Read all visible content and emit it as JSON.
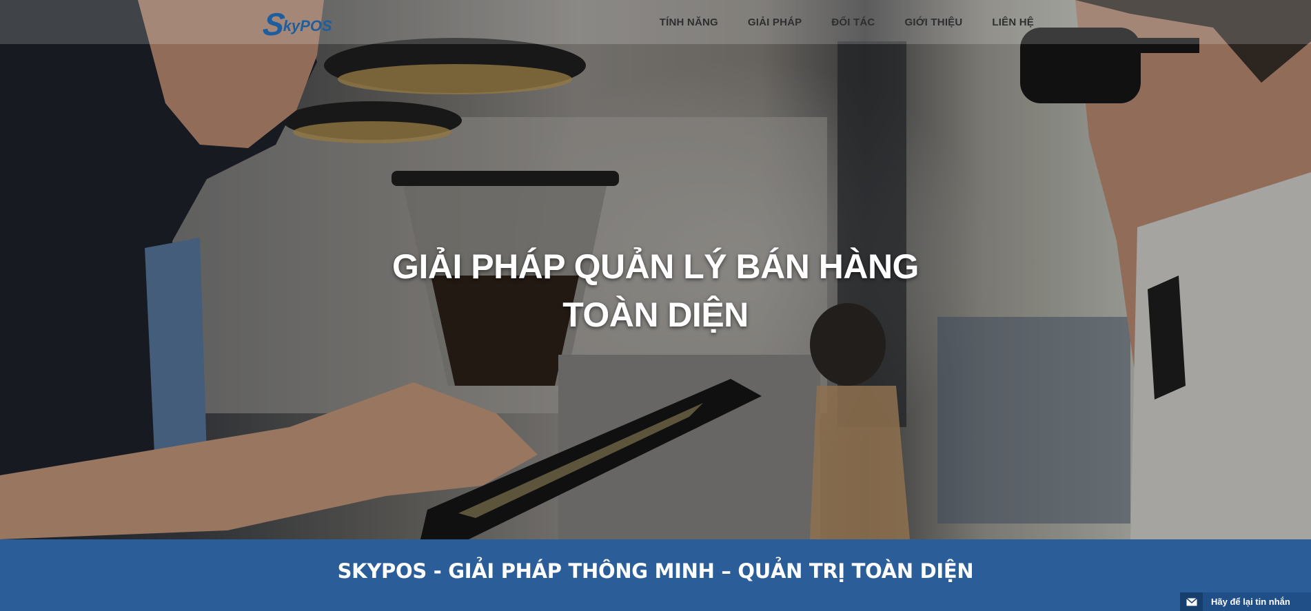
{
  "brand": {
    "logo_initial": "S",
    "logo_rest": "kyPOS",
    "accent_color": "#1f5e9e"
  },
  "nav": {
    "items": [
      {
        "label": "TÍNH NĂNG"
      },
      {
        "label": "GIẢI PHÁP"
      },
      {
        "label": "ĐỐI TÁC"
      },
      {
        "label": "GIỚI THIỆU"
      },
      {
        "label": "LIÊN HỆ"
      }
    ]
  },
  "hero": {
    "headline_line1": "GIẢI PHÁP QUẢN LÝ BÁN HÀNG",
    "headline_line2": "TOÀN DIỆN"
  },
  "band": {
    "title": "SKYPOS - GIẢI PHÁP THÔNG MINH – QUẢN TRỊ TOÀN DIỆN",
    "color": "#2b5e99"
  },
  "chat_widget": {
    "label": "Hãy để lại tin nhắn",
    "icon": "envelope-icon"
  }
}
